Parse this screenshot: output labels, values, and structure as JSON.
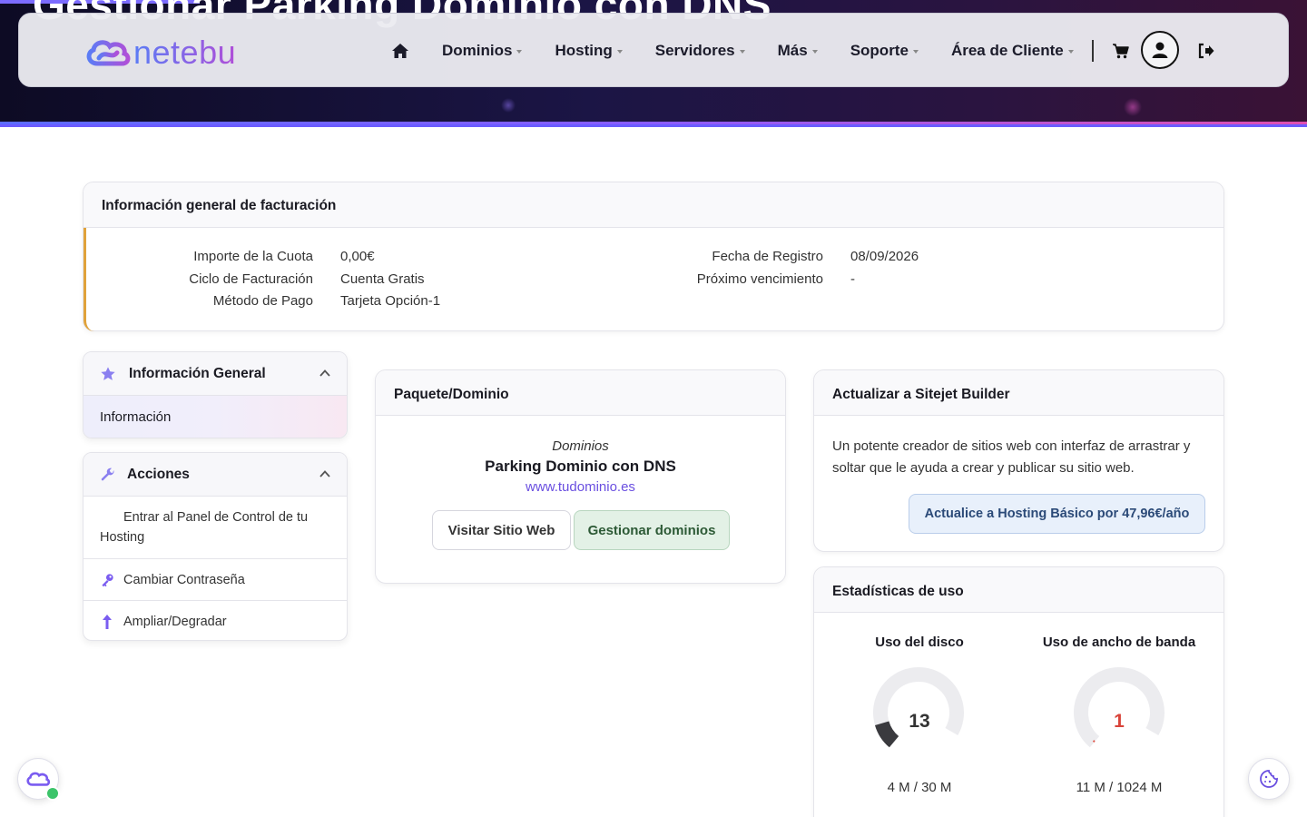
{
  "hero": {
    "title": "Gestionar Parking Dominio con DNS"
  },
  "brand": {
    "name": "netebu"
  },
  "nav": {
    "items": [
      {
        "label": "Dominios"
      },
      {
        "label": "Hosting"
      },
      {
        "label": "Servidores"
      },
      {
        "label": "Más"
      },
      {
        "label": "Soporte"
      },
      {
        "label": "Área de Cliente"
      }
    ]
  },
  "billing": {
    "title": "Información general de facturación",
    "rows_left": [
      {
        "label": "Importe de la Cuota",
        "value": "0,00€"
      },
      {
        "label": "Ciclo de Facturación",
        "value": "Cuenta Gratis"
      },
      {
        "label": "Método de Pago",
        "value": "Tarjeta Opción-1"
      }
    ],
    "rows_right": [
      {
        "label": "Fecha de Registro",
        "value": "08/09/2026"
      },
      {
        "label": "Próximo vencimiento",
        "value": "-"
      }
    ]
  },
  "sidebar": {
    "general": {
      "title": "Información General",
      "items": [
        {
          "label": "Información"
        }
      ]
    },
    "actions": {
      "title": "Acciones",
      "items": [
        {
          "label": "Entrar al Panel de Control de tu Hosting"
        },
        {
          "label": "Cambiar Contraseña"
        },
        {
          "label": "Ampliar/Degradar"
        }
      ]
    }
  },
  "package": {
    "title": "Paquete/Dominio",
    "group": "Dominios",
    "name": "Parking Dominio con DNS",
    "domain": "www.tudominio.es",
    "visit_label": "Visitar Sitio Web",
    "manage_label": "Gestionar dominios"
  },
  "sitejet": {
    "title": "Actualizar a Sitejet Builder",
    "description": "Un potente creador de sitios web con interfaz de arrastrar y soltar que le ayuda a crear y publicar su sitio web.",
    "button_label": "Actualice a Hosting Básico por 47,96€/año"
  },
  "usage": {
    "title": "Estadísticas de uso",
    "disk": {
      "label": "Uso del disco",
      "percent": "13",
      "fraction": 0.13,
      "detail": "4 M / 30 M"
    },
    "bandwidth": {
      "label": "Uso de ancho de banda",
      "percent": "1",
      "fraction": 0.01,
      "detail": "11 M / 1024 M"
    }
  },
  "colors": {
    "accent": "#7a5cf0",
    "warning_border": "#e0a23a",
    "manage_bg": "#e3f1e6",
    "upgrade_bg": "#e8f0fb"
  }
}
